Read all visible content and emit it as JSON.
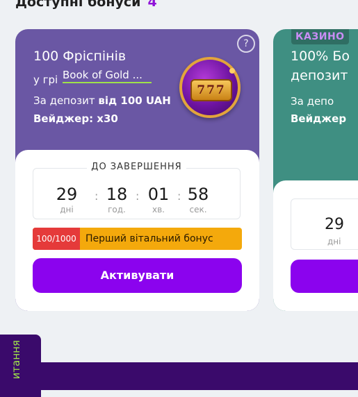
{
  "section": {
    "title": "Доступні бонуси",
    "count": "4"
  },
  "cards": [
    {
      "title": "100 Фріспінів",
      "game_prefix": "у грі",
      "game_name": "Book of Gold ...",
      "deposit_prefix": "За депозит",
      "deposit_value": "від 100 UAH",
      "wager": "Вейджер: x30",
      "help_icon": "?",
      "slot_symbols": "777",
      "timer_label": "ДО ЗАВЕРШЕННЯ",
      "timer": [
        {
          "value": "29",
          "unit": "дні"
        },
        {
          "value": "18",
          "unit": "год."
        },
        {
          "value": "01",
          "unit": "хв."
        },
        {
          "value": "58",
          "unit": "сек."
        }
      ],
      "timer_separator": ":",
      "status_count": "100/1000",
      "status_text": "Перший вітальний бонус",
      "button_label": "Активувати"
    },
    {
      "badge": "КАЗИНО",
      "title_line1": "100% Бо",
      "title_line2": "депозит",
      "deposit_prefix": "За депо",
      "wager": "Вейджер",
      "timer_value": "29",
      "timer_unit": "дні"
    }
  ],
  "feedback_tab": "итання",
  "colors": {
    "accent": "#8b03ee",
    "card1": "#6a57a4",
    "card2": "#3f8f82",
    "status": "#f4a90c",
    "count": "#e53a3a"
  }
}
